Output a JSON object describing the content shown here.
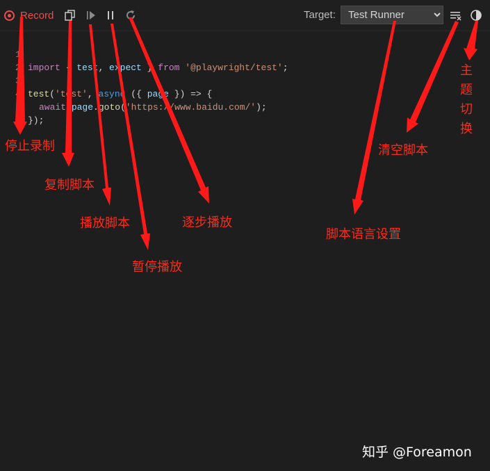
{
  "toolbar": {
    "record_label": "Record",
    "target_label": "Target:",
    "target_value": "Test Runner",
    "target_options": [
      "Test Runner"
    ],
    "icons": [
      "record-icon",
      "copy-icon",
      "play-icon",
      "pause-icon",
      "step-icon",
      "clear-icon",
      "theme-icon"
    ]
  },
  "editor": {
    "line_numbers": [
      "1",
      "2",
      "3",
      "4",
      "5"
    ],
    "line1": {
      "import": "import",
      "open": " { ",
      "test": "test",
      "comma": ", ",
      "expect": "expect",
      "close": " } ",
      "from": "from",
      "module": "'@playwright/test'",
      "semi": ";"
    },
    "line3": {
      "test": "test",
      "open": "(",
      "name": "'test'",
      "comma": ", ",
      "async": "async",
      "args_open": " ({ ",
      "page": "page",
      "args_close": " }) => {"
    },
    "line4": {
      "await": "await",
      "page": " page",
      "dot": ".",
      "goto": "goto",
      "open": "(",
      "url": "'https://www.baidu.com/'",
      "close": ");"
    },
    "line5": "});"
  },
  "annotations": {
    "stop_recording": "停止录制",
    "copy_script": "复制脚本",
    "play_script": "播放脚本",
    "pause_playback": "暂停播放",
    "step_playback": "逐步播放",
    "script_language": "脚本语言设置",
    "clear_script": "清空脚本",
    "theme_switch": [
      "主",
      "题",
      "切",
      "换"
    ]
  },
  "watermark": "知乎 @Foreamon",
  "colors": {
    "accent": "#f14c4c",
    "annotation": "#ff2a1a",
    "background": "#1e1e1e"
  }
}
